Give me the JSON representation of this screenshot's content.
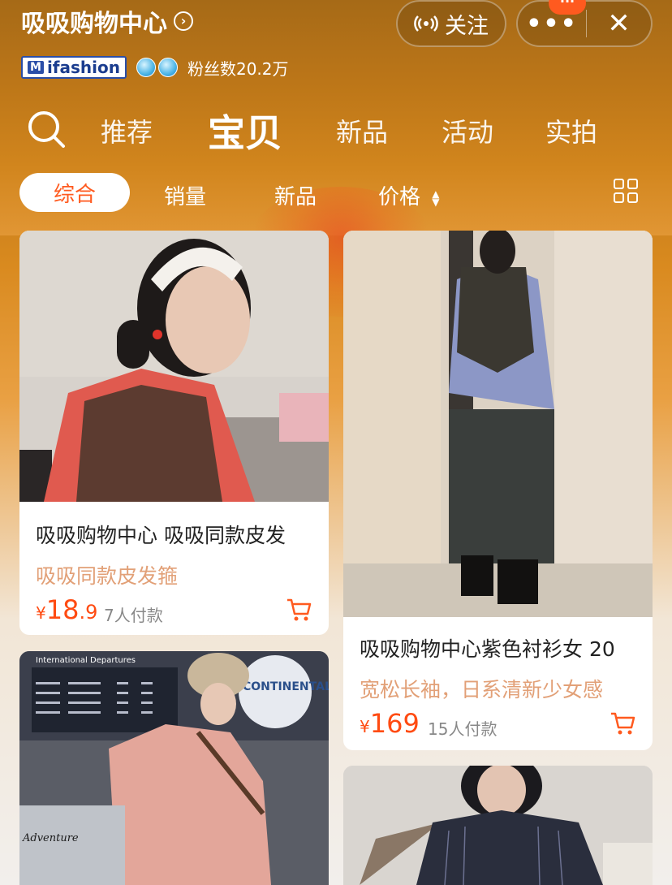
{
  "header": {
    "shop_name": "吸吸购物中心",
    "follow_label": "关注",
    "more_label": "•••",
    "notice_badge": "···",
    "close_label": "✕",
    "brand_badge": "ifashion",
    "fans_text": "粉丝数20.2万"
  },
  "nav_tabs": [
    {
      "label": "推荐",
      "active": false
    },
    {
      "label": "宝贝",
      "active": true
    },
    {
      "label": "新品",
      "active": false
    },
    {
      "label": "活动",
      "active": false
    },
    {
      "label": "实拍",
      "active": false
    }
  ],
  "filters": {
    "comprehensive": "综合",
    "sales": "销量",
    "new": "新品",
    "price": "价格"
  },
  "products": [
    {
      "title": "吸吸购物中心 吸吸同款皮发",
      "subtitle": "吸吸同款皮发箍",
      "price_yen": "¥",
      "price_int": "18",
      "price_dec": ".9",
      "sold": "7人付款"
    },
    {
      "title": "吸吸购物中心紫色衬衫女 20",
      "subtitle": "宽松长袖，日系清新少女感",
      "price_yen": "¥",
      "price_int": "169",
      "price_dec": "",
      "sold": "15人付款"
    }
  ],
  "photo_text": {
    "departures": "International Departures",
    "adventure": "Adventure",
    "logo": "CONTINENTAL"
  },
  "colors": {
    "accent": "#ff5a1f",
    "price": "#ff4b12",
    "subtitle": "#e2a077"
  }
}
